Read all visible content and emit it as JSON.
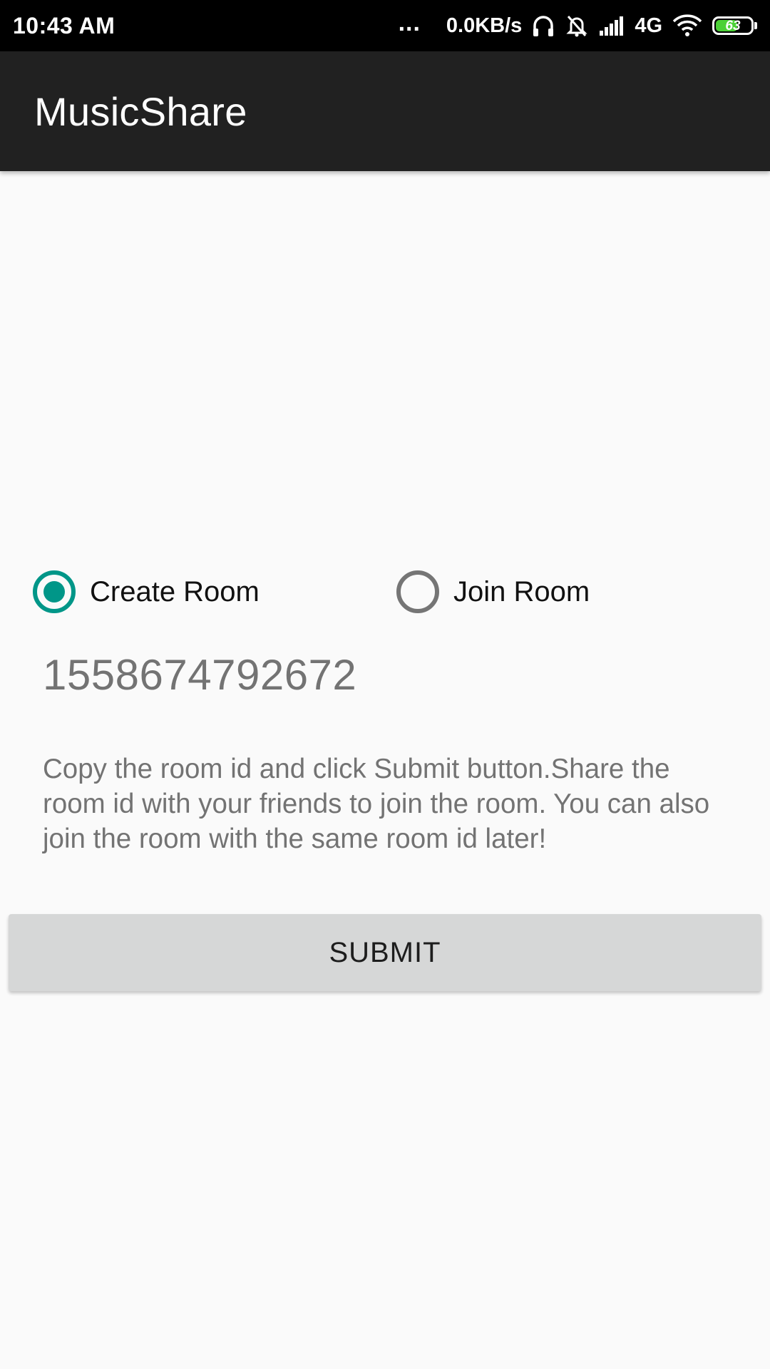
{
  "status_bar": {
    "time": "10:43 AM",
    "more_dots": "...",
    "net_speed": "0.0KB/s",
    "network_type": "4G",
    "battery_level": "63",
    "battery_fraction": 0.63,
    "battery_color": "#4cd137",
    "icons": [
      "headphones-icon",
      "mute-alarm-icon",
      "signal-icon",
      "wifi-icon",
      "battery-icon"
    ]
  },
  "app_bar": {
    "title": "MusicShare",
    "background": "#212121"
  },
  "room_mode": {
    "options": [
      {
        "label": "Create Room",
        "checked": true
      },
      {
        "label": "Join Room",
        "checked": false
      }
    ],
    "accent_color": "#009688"
  },
  "room_id": "1558674792672",
  "instructions": "Copy the room id and click Submit button.Share the room id with your friends to join the room. You can also join the room with the same room id later!",
  "submit": {
    "label": "SUBMIT"
  }
}
